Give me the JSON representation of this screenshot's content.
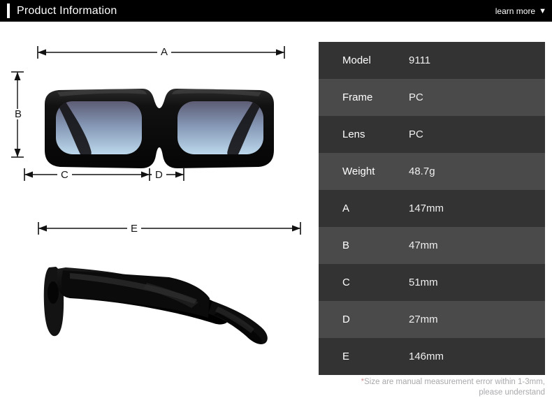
{
  "header": {
    "title": "Product Information",
    "learn_more_label": "learn more",
    "caret_glyph": "▼",
    "background_color": "#000000",
    "accent_color": "#ffffff"
  },
  "diagram": {
    "front_view_name": "sunglasses-front-view",
    "side_view_name": "sunglasses-side-view",
    "frame_color": "#0d0d0d",
    "lens_gradient_top": "#5d5c74",
    "lens_gradient_bottom": "#bcd8ec",
    "dimension_labels": {
      "a": "A",
      "b": "B",
      "c": "C",
      "d": "D",
      "e": "E"
    }
  },
  "spec_table": {
    "row_color_odd": "#333333",
    "row_color_even": "#4a4a4a",
    "rows": [
      {
        "key": "Model",
        "value": "9111"
      },
      {
        "key": "Frame",
        "value": "PC"
      },
      {
        "key": "Lens",
        "value": "PC"
      },
      {
        "key": "Weight",
        "value": "48.7g"
      },
      {
        "key": "A",
        "value": "147mm"
      },
      {
        "key": "B",
        "value": "47mm"
      },
      {
        "key": "C",
        "value": "51mm"
      },
      {
        "key": "D",
        "value": "27mm"
      },
      {
        "key": "E",
        "value": "146mm"
      }
    ],
    "note_star": "*",
    "note_line1": "Size are manual measurement error within 1-3mm,",
    "note_line2": "please understand"
  }
}
